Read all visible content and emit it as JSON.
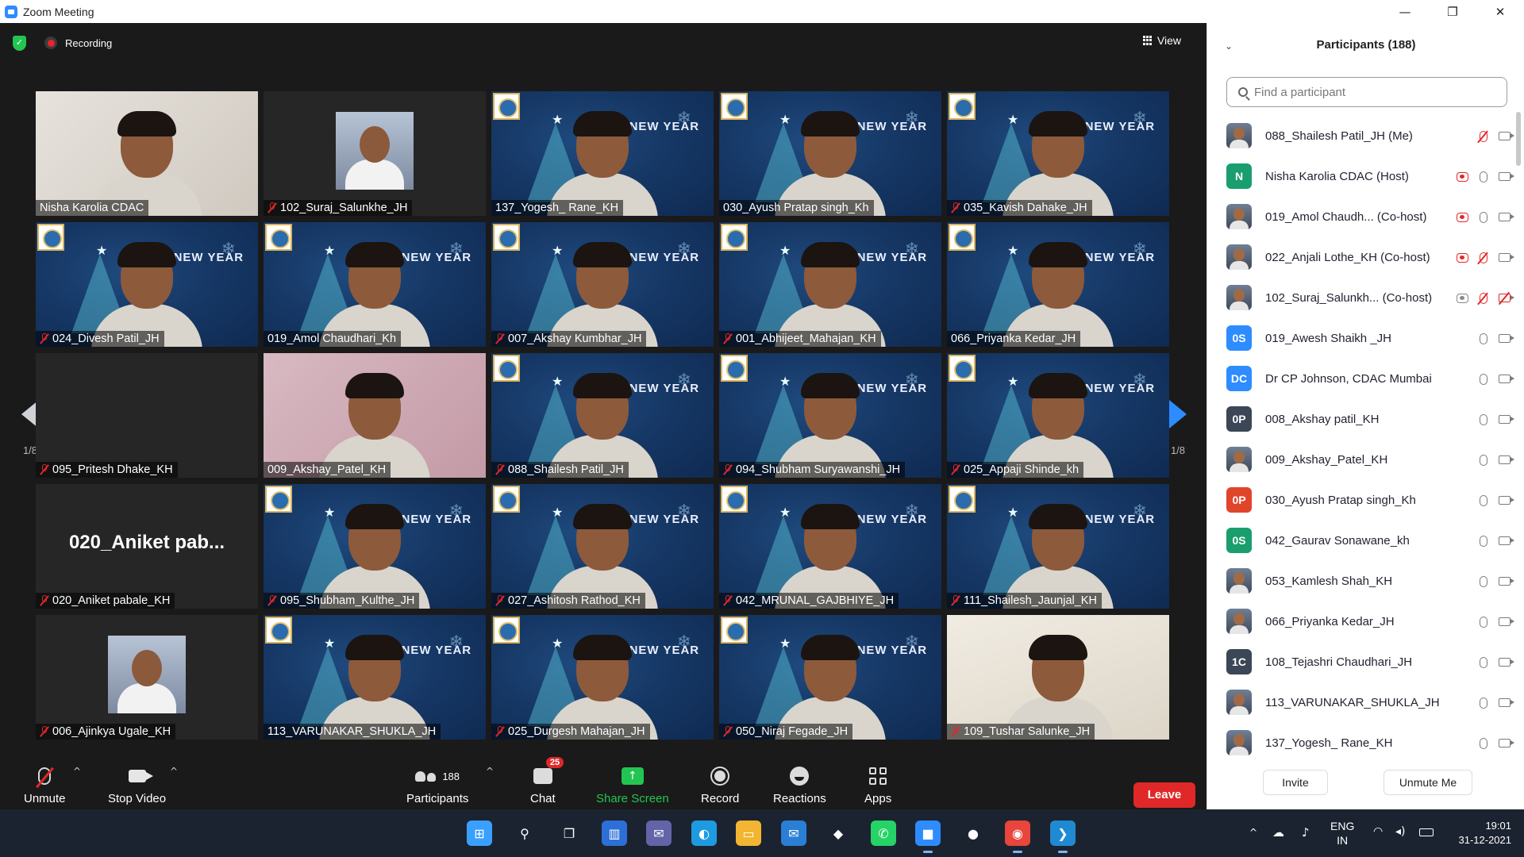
{
  "window": {
    "title": "Zoom Meeting",
    "controls": {
      "minimize": "—",
      "restore": "❐",
      "close": "✕"
    }
  },
  "topbar": {
    "recording_label": "Recording",
    "view_label": "View"
  },
  "nav": {
    "page_left": "1/8",
    "page_right": "1/8"
  },
  "tiles": [
    {
      "name": "Nisha Karolia CDAC",
      "muted": false,
      "style": "bright"
    },
    {
      "name": "102_Suraj_Salunkhe_JH",
      "muted": true,
      "style": "avatar"
    },
    {
      "name": "137_Yogesh_ Rane_KH",
      "muted": false,
      "style": "xmas"
    },
    {
      "name": "030_Ayush Pratap singh_Kh",
      "muted": false,
      "style": "xmas"
    },
    {
      "name": "035_Kavish Dahake_JH",
      "muted": true,
      "style": "xmas"
    },
    {
      "name": "024_Divesh Patil_JH",
      "muted": true,
      "style": "xmas"
    },
    {
      "name": "019_Amol Chaudhari_Kh",
      "muted": false,
      "style": "xmas"
    },
    {
      "name": "007_Akshay Kumbhar_JH",
      "muted": true,
      "style": "xmas"
    },
    {
      "name": "001_Abhijeet_Mahajan_KH",
      "muted": true,
      "style": "xmas"
    },
    {
      "name": "066_Priyanka Kedar_JH",
      "muted": false,
      "style": "xmas"
    },
    {
      "name": "095_Pritesh Dhake_KH",
      "muted": true,
      "style": "blank"
    },
    {
      "name": "009_Akshay_Patel_KH",
      "muted": false,
      "style": "pink"
    },
    {
      "name": "088_Shailesh Patil_JH",
      "muted": true,
      "style": "xmas"
    },
    {
      "name": "094_Shubham Suryawanshi_JH",
      "muted": true,
      "style": "xmas"
    },
    {
      "name": "025_Appaji Shinde_kh",
      "muted": true,
      "style": "xmas"
    },
    {
      "name": "020_Aniket pabale_KH",
      "muted": true,
      "style": "nametile",
      "big_name": "020_Aniket pab..."
    },
    {
      "name": "095_Shubham_Kulthe_JH",
      "muted": true,
      "style": "xmas"
    },
    {
      "name": "027_Ashitosh Rathod_KH",
      "muted": true,
      "style": "xmas"
    },
    {
      "name": "042_MRUNAL_GAJBHIYE_JH",
      "muted": true,
      "style": "xmas"
    },
    {
      "name": "111_Shailesh_Jaunjal_KH",
      "muted": true,
      "style": "xmas"
    },
    {
      "name": "006_Ajinkya Ugale_KH",
      "muted": true,
      "style": "avatar"
    },
    {
      "name": "113_VARUNAKAR_SHUKLA_JH",
      "muted": false,
      "style": "xmas"
    },
    {
      "name": "025_Durgesh Mahajan_JH",
      "muted": true,
      "style": "xmas"
    },
    {
      "name": "050_Niraj Fegade_JH",
      "muted": true,
      "style": "xmas"
    },
    {
      "name": "109_Tushar Salunke_JH",
      "muted": true,
      "style": "white"
    }
  ],
  "xmas_greeting": "HAPPY NEW YEAR",
  "toolbar": {
    "unmute": "Unmute",
    "stop_video": "Stop Video",
    "participants": "Participants",
    "participants_count": "188",
    "chat": "Chat",
    "chat_badge": "25",
    "share_screen": "Share Screen",
    "record": "Record",
    "reactions": "Reactions",
    "apps": "Apps",
    "leave": "Leave"
  },
  "panel": {
    "title": "Participants (188)",
    "search_placeholder": "Find a participant",
    "participants": [
      {
        "name": "088_Shailesh Patil_JH (Me)",
        "avatar": "photo",
        "initials": "",
        "color": "#5b6b80",
        "host_rec": false,
        "mic_off": true,
        "cam_off": false
      },
      {
        "name": "Nisha Karolia CDAC (Host)",
        "avatar": "initials",
        "initials": "N",
        "color": "#1a9e6e",
        "host_rec": true,
        "mic_off": false,
        "cam_off": false
      },
      {
        "name": "019_Amol Chaudh... (Co-host)",
        "avatar": "photo",
        "initials": "",
        "color": "#c05a2a",
        "host_rec": true,
        "mic_off": false,
        "cam_off": false
      },
      {
        "name": "022_Anjali Lothe_KH (Co-host)",
        "avatar": "photo",
        "initials": "",
        "color": "#7a5a4a",
        "host_rec": true,
        "mic_off": true,
        "cam_off": false
      },
      {
        "name": "102_Suraj_Salunkh... (Co-host)",
        "avatar": "photo",
        "initials": "",
        "color": "#6a7a90",
        "host_rec": true,
        "mic_off": true,
        "cam_off": true
      },
      {
        "name": "019_Awesh Shaikh _JH",
        "avatar": "initials",
        "initials": "0S",
        "color": "#2d8cff",
        "host_rec": false,
        "mic_off": false,
        "cam_off": false
      },
      {
        "name": "Dr CP Johnson, CDAC Mumbai",
        "avatar": "initials",
        "initials": "DC",
        "color": "#2d8cff",
        "host_rec": false,
        "mic_off": false,
        "cam_off": false
      },
      {
        "name": "008_Akshay patil_KH",
        "avatar": "initials",
        "initials": "0P",
        "color": "#3b4656",
        "host_rec": false,
        "mic_off": false,
        "cam_off": false
      },
      {
        "name": "009_Akshay_Patel_KH",
        "avatar": "photo",
        "initials": "",
        "color": "#8a6a3a",
        "host_rec": false,
        "mic_off": false,
        "cam_off": false
      },
      {
        "name": "030_Ayush Pratap singh_Kh",
        "avatar": "initials",
        "initials": "0P",
        "color": "#e0452c",
        "host_rec": false,
        "mic_off": false,
        "cam_off": false
      },
      {
        "name": "042_Gaurav Sonawane_kh",
        "avatar": "initials",
        "initials": "0S",
        "color": "#1a9e6e",
        "host_rec": false,
        "mic_off": false,
        "cam_off": false
      },
      {
        "name": "053_Kamlesh Shah_KH",
        "avatar": "photo",
        "initials": "",
        "color": "#4a5a70",
        "host_rec": false,
        "mic_off": false,
        "cam_off": false
      },
      {
        "name": "066_Priyanka Kedar_JH",
        "avatar": "photo",
        "initials": "",
        "color": "#8a7a6a",
        "host_rec": false,
        "mic_off": false,
        "cam_off": false
      },
      {
        "name": "108_Tejashri Chaudhari_JH",
        "avatar": "initials",
        "initials": "1C",
        "color": "#3b4656",
        "host_rec": false,
        "mic_off": false,
        "cam_off": false
      },
      {
        "name": "113_VARUNAKAR_SHUKLA_JH",
        "avatar": "photo",
        "initials": "",
        "color": "#b04a3a",
        "host_rec": false,
        "mic_off": false,
        "cam_off": false
      },
      {
        "name": "137_Yogesh_ Rane_KH",
        "avatar": "photo",
        "initials": "",
        "color": "#3a3a3a",
        "host_rec": false,
        "mic_off": false,
        "cam_off": false
      }
    ],
    "invite": "Invite",
    "unmute_me": "Unmute Me"
  },
  "taskbar": {
    "lang_line1": "ENG",
    "lang_line2": "IN",
    "time": "19:01",
    "date": "31-12-2021",
    "apps": [
      {
        "name": "start-icon",
        "glyph": "⊞",
        "color": "#3aa0ff",
        "active": false
      },
      {
        "name": "search-icon",
        "glyph": "⚲",
        "color": "transparent",
        "active": false
      },
      {
        "name": "task-view-icon",
        "glyph": "❐",
        "color": "transparent",
        "active": false
      },
      {
        "name": "widgets-icon",
        "glyph": "▥",
        "color": "#2d6fd6",
        "active": false
      },
      {
        "name": "teams-chat-icon",
        "glyph": "✉",
        "color": "#6264a7",
        "active": false
      },
      {
        "name": "edge-icon",
        "glyph": "◐",
        "color": "#1e9be0",
        "active": false
      },
      {
        "name": "file-explorer-icon",
        "glyph": "▭",
        "color": "#f2b531",
        "active": false
      },
      {
        "name": "mail-icon",
        "glyph": "✉",
        "color": "#2a7fd4",
        "active": false
      },
      {
        "name": "dropbox-icon",
        "glyph": "◆",
        "color": "transparent",
        "active": false
      },
      {
        "name": "whatsapp-icon",
        "glyph": "✆",
        "color": "#25d366",
        "active": false
      },
      {
        "name": "zoom-icon",
        "glyph": "■",
        "color": "#2d8cff",
        "active": true
      },
      {
        "name": "github-icon",
        "glyph": "●",
        "color": "transparent",
        "active": false
      },
      {
        "name": "chrome-icon",
        "glyph": "◉",
        "color": "#e8453c",
        "active": true
      },
      {
        "name": "vscode-icon",
        "glyph": "❯",
        "color": "#1f8ad2",
        "active": true
      }
    ]
  }
}
